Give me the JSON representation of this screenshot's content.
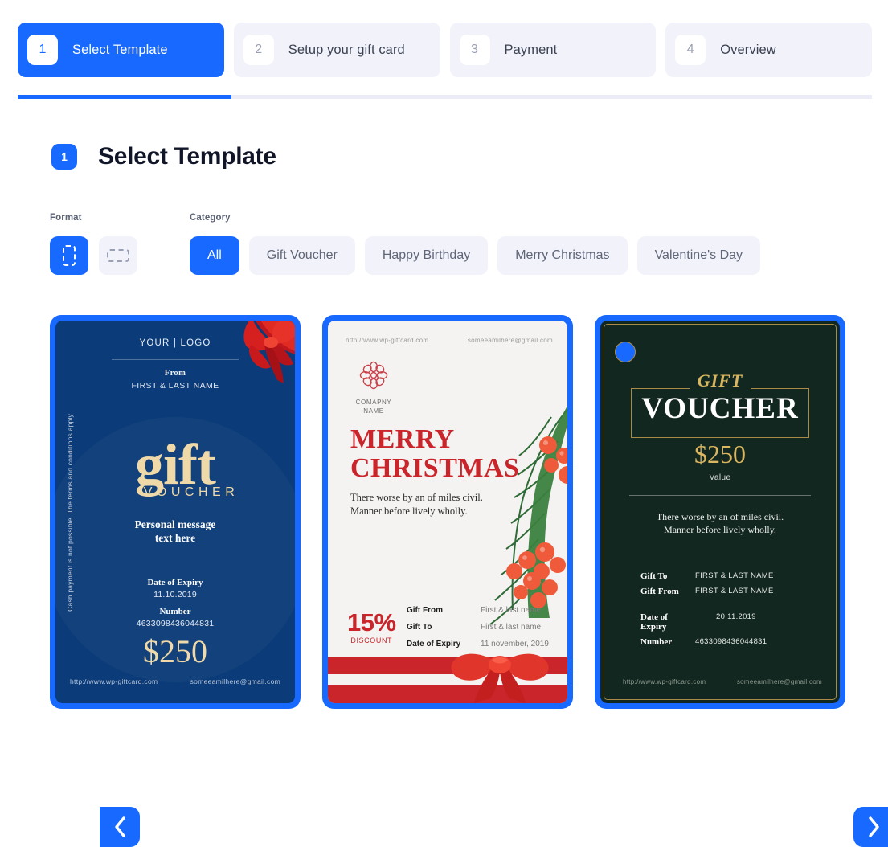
{
  "stepper": {
    "steps": [
      {
        "num": "1",
        "label": "Select Template",
        "active": true
      },
      {
        "num": "2",
        "label": "Setup your gift card",
        "active": false
      },
      {
        "num": "3",
        "label": "Payment",
        "active": false
      },
      {
        "num": "4",
        "label": "Overview",
        "active": false
      }
    ]
  },
  "progress": {
    "percent": 25
  },
  "section": {
    "badge": "1",
    "title": "Select Template"
  },
  "filters": {
    "format_caption": "Format",
    "category_caption": "Category",
    "formats": [
      {
        "name": "portrait",
        "selected": true
      },
      {
        "name": "landscape",
        "selected": false
      }
    ],
    "categories": [
      {
        "label": "All",
        "selected": true
      },
      {
        "label": "Gift Voucher",
        "selected": false
      },
      {
        "label": "Happy Birthday",
        "selected": false
      },
      {
        "label": "Merry Christmas",
        "selected": false
      },
      {
        "label": "Valentine's Day",
        "selected": false
      }
    ]
  },
  "carousel": {
    "prev_label": "‹",
    "next_label": "›"
  },
  "templates": {
    "card1": {
      "logo": "YOUR | LOGO",
      "from_label": "From",
      "from_value": "FIRST & LAST NAME",
      "gift": "gift",
      "voucher": "VOUCHER",
      "message": "Personal message\ntext here",
      "expiry_label": "Date of Expiry",
      "expiry_value": "11.10.2019",
      "number_label": "Number",
      "number_value": "4633098436044831",
      "amount": "$250",
      "footer_url": "http://www.wp-giftcard.com",
      "footer_email": "someeamilhere@gmail.com",
      "side_text": "Cash payment is not possible. The terms and conditions apply.",
      "colors": {
        "frame": "#1769ff",
        "background": "#0b3b78",
        "accent": "#efd9a8"
      }
    },
    "card2": {
      "top_url": "http://www.wp-giftcard.com",
      "top_email": "someeamilhere@gmail.com",
      "brand_name": "COMAPNY\nNAME",
      "title_line1": "MERRY",
      "title_line2": "CHRISTMAS",
      "message": "There worse by an of miles civil.\nManner before lively wholly.",
      "discount_number": "15%",
      "discount_word": "DISCOUNT",
      "rows": [
        {
          "label": "Gift From",
          "value": "First & last name"
        },
        {
          "label": "Gift To",
          "value": "First & last name"
        },
        {
          "label": "Date of Expiry",
          "value": "11 november, 2019"
        }
      ],
      "colors": {
        "frame": "#1769ff",
        "background": "#f4f3f1",
        "accent": "#c9252b"
      }
    },
    "card3": {
      "gift": "GIFT",
      "voucher": "VOUCHER",
      "amount": "$250",
      "value_label": "Value",
      "message": "There worse by an of miles civil.\nManner before lively wholly.",
      "rows": [
        {
          "label": "Gift To",
          "value": "FIRST & LAST NAME"
        },
        {
          "label": "Gift From",
          "value": "FIRST & LAST NAME"
        },
        {
          "label": "Date of Expiry",
          "value": "20.11.2019"
        },
        {
          "label": "Number",
          "value": "4633098436044831"
        }
      ],
      "footer_url": "http://www.wp-giftcard.com",
      "footer_email": "someeamilhere@gmail.com",
      "colors": {
        "frame": "#1769ff",
        "background": "#132721",
        "accent": "#d9b65f"
      }
    }
  }
}
